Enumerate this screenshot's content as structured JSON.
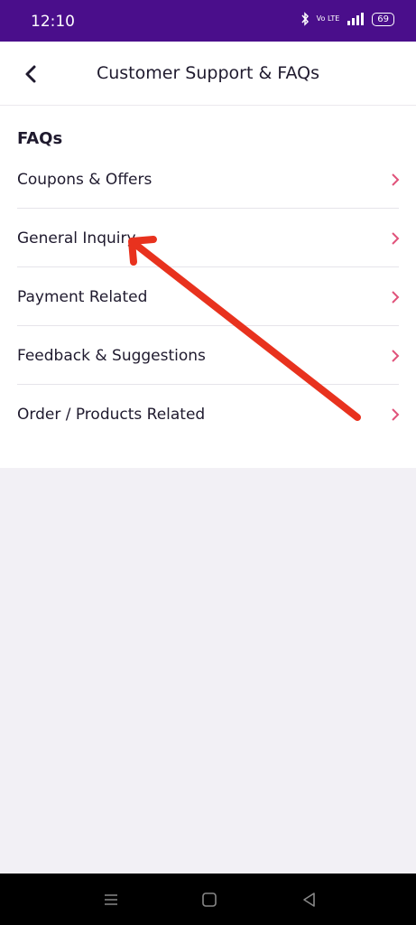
{
  "status_bar": {
    "time": "12:10",
    "network": "Vo LTE",
    "battery": "69"
  },
  "header": {
    "title": "Customer Support & FAQs"
  },
  "faq": {
    "section_title": "FAQs",
    "items": [
      {
        "label": "Coupons & Offers"
      },
      {
        "label": "General Inquiry"
      },
      {
        "label": "Payment Related"
      },
      {
        "label": "Feedback & Suggestions"
      },
      {
        "label": "Order / Products Related"
      }
    ]
  },
  "colors": {
    "statusbar": "#4a0e8b",
    "chevron": "#e0527a",
    "annotation_arrow": "#e8321e",
    "background": "#f2f0f5"
  }
}
